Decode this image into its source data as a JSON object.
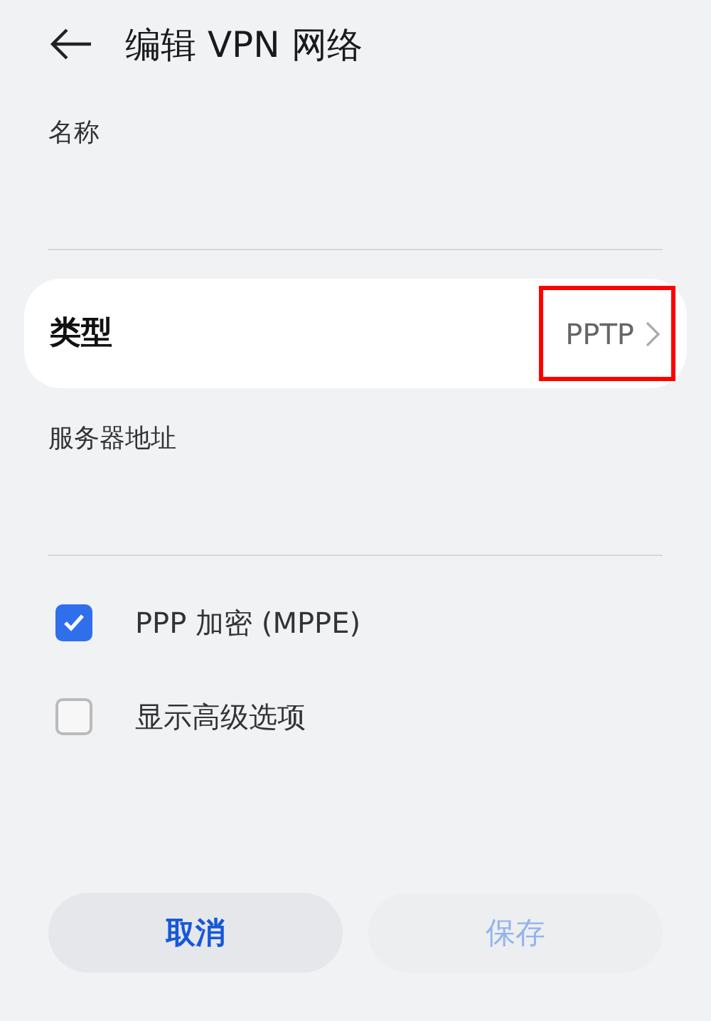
{
  "header": {
    "back_icon": true,
    "title": "编辑 VPN 网络"
  },
  "fields": [
    {
      "kind": "text",
      "label": "名称"
    },
    {
      "kind": "select",
      "label": "类型",
      "value": "PPTP",
      "highlighted": true
    },
    {
      "kind": "text",
      "label": "服务器地址"
    }
  ],
  "options": [
    {
      "label": "PPP 加密 (MPPE)",
      "checked": true
    },
    {
      "label": "显示高级选项",
      "checked": false
    }
  ],
  "buttons": [
    {
      "label": "取消",
      "disabled": false
    },
    {
      "label": "保存",
      "disabled": true
    }
  ]
}
